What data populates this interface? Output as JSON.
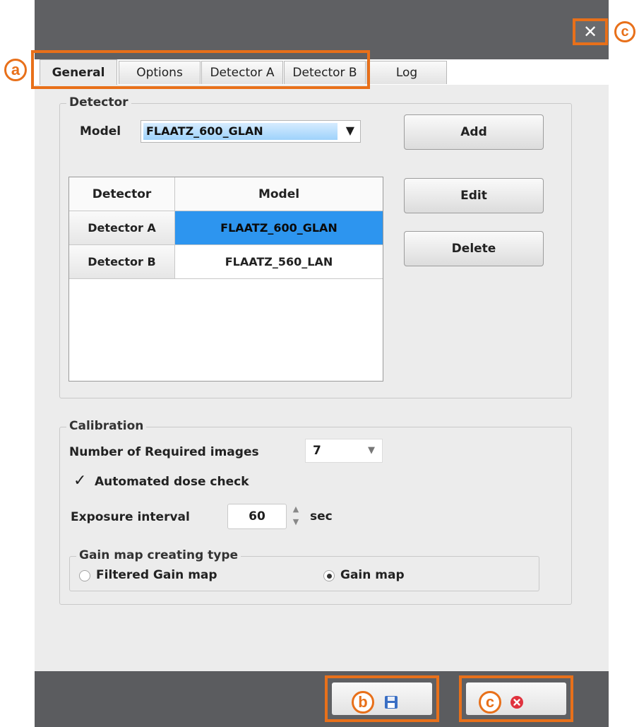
{
  "window": {
    "close_glyph": "✕"
  },
  "annotations": {
    "tabs": "a",
    "save": "b",
    "close_top": "c",
    "close_bottom": "c"
  },
  "tabs": [
    {
      "label": "General",
      "active": true
    },
    {
      "label": "Options",
      "active": false
    },
    {
      "label": "Detector A",
      "active": false
    },
    {
      "label": "Detector B",
      "active": false
    },
    {
      "label": "Log",
      "active": false
    }
  ],
  "detector_group": {
    "legend": "Detector",
    "model_label": "Model",
    "model_value": "FLAATZ_600_GLAN",
    "add_label": "Add",
    "edit_label": "Edit",
    "delete_label": "Delete",
    "table": {
      "columns": [
        "Detector",
        "Model"
      ],
      "rows": [
        {
          "detector": "Detector A",
          "model": "FLAATZ_600_GLAN",
          "selected": true
        },
        {
          "detector": "Detector B",
          "model": "FLAATZ_560_LAN",
          "selected": false
        }
      ]
    }
  },
  "calibration_group": {
    "legend": "Calibration",
    "required_images_label": "Number of Required images",
    "required_images_value": "7",
    "dose_check_label": "Automated dose check",
    "dose_check_checked": true,
    "exposure_label": "Exposure interval",
    "exposure_value": "60",
    "exposure_unit": "sec",
    "gain_group": {
      "legend": "Gain map creating type",
      "options": [
        {
          "label": "Filtered Gain map",
          "selected": false
        },
        {
          "label": "Gain map",
          "selected": true
        }
      ]
    }
  },
  "colors": {
    "annotation": "#e8701a",
    "selection": "#2d95ef",
    "frame": "#5f6063"
  },
  "icons": {
    "save": "floppy-disk-icon",
    "cancel": "cancel-x-icon"
  }
}
